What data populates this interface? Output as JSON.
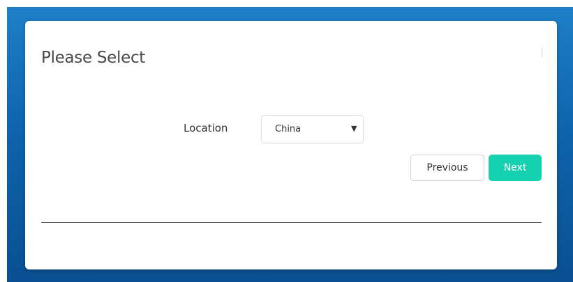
{
  "dialog": {
    "title": "Please Select"
  },
  "form": {
    "location_label": "Location",
    "location_value": "China",
    "location_arrow": "▼"
  },
  "buttons": {
    "previous_label": "Previous",
    "next_label": "Next"
  },
  "colors": {
    "accent": "#16d1b0",
    "backdrop": "#0e64ad"
  }
}
